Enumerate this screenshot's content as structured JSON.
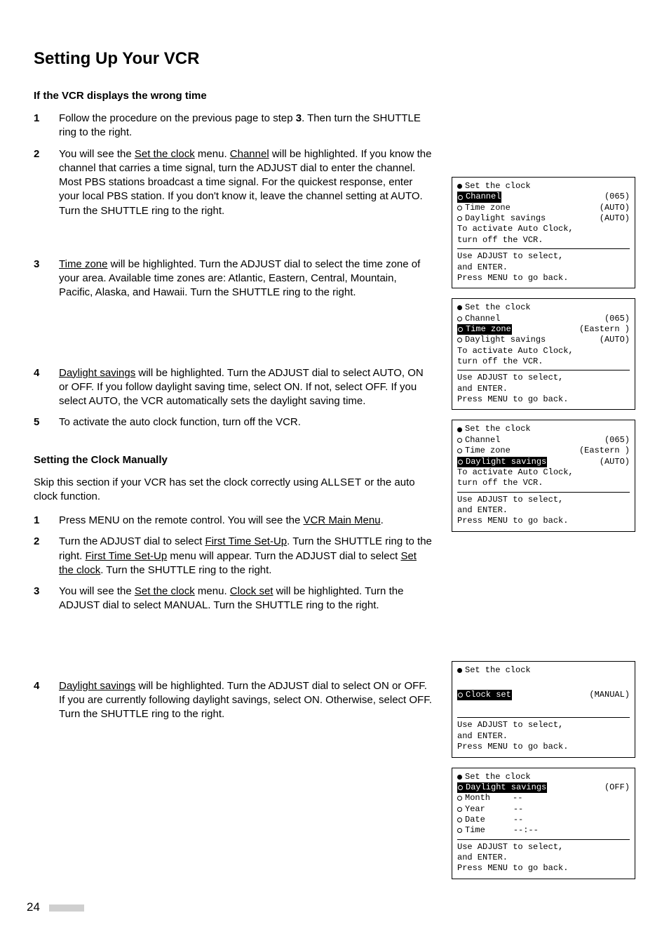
{
  "title": "Setting Up Your VCR",
  "section1": {
    "heading": "If the VCR displays the wrong time",
    "steps": {
      "s1": {
        "n": "1",
        "a": "Follow the procedure on the previous page to step ",
        "b": "3",
        "c": ".  Then turn the SHUTTLE ring to the right."
      },
      "s2": {
        "n": "2",
        "a": "You will see the ",
        "u1": "Set the clock",
        "b": " menu.  ",
        "u2": "Channel",
        "c": " will be highlighted.  If you know the channel that carries a time signal, turn the ADJUST dial to enter the channel.  Most PBS stations broadcast a time signal.  For the quickest response, enter your local PBS station.  If you don't know it, leave the channel setting at AUTO.  Turn the SHUTTLE ring to the right."
      },
      "s3": {
        "n": "3",
        "u1": "Time zone",
        "a": " will be highlighted.  Turn the ADJUST dial to select the time zone of your area.  Available time zones are:  Atlantic, Eastern, Central, Mountain, Pacific, Alaska, and Hawaii.  Turn the SHUTTLE ring to the right."
      },
      "s4": {
        "n": "4",
        "u1": "Daylight savings",
        "a": " will be highlighted.  Turn the ADJUST dial to select AUTO, ON or OFF.  If you follow daylight saving time, select ON.  If not, select OFF.  If you select AUTO, the VCR automatically sets the daylight saving time."
      },
      "s5": {
        "n": "5",
        "a": "To activate the auto clock function, turn off the VCR."
      }
    }
  },
  "section2": {
    "heading": "Setting the Clock Manually",
    "intro_a": "Skip this section if your VCR has set the clock correctly using A",
    "intro_sc": "LLSET",
    "intro_b": " or the auto clock function.",
    "steps": {
      "s1": {
        "n": "1",
        "a": "Press MENU on the remote control.  You will see the ",
        "u1": "VCR Main Menu",
        "b": "."
      },
      "s2": {
        "n": "2",
        "a": "Turn the ADJUST dial to select ",
        "u1": "First Time Set-Up",
        "b": ".  Turn the SHUTTLE ring to the right.  ",
        "u2": "First Time Set-Up",
        "c": " menu will appear.  Turn the ADJUST dial to select ",
        "u3": "Set the clock",
        "d": ".  Turn the SHUTTLE ring to the right."
      },
      "s3": {
        "n": "3",
        "a": "You will see the ",
        "u1": "Set the clock",
        "b": " menu.  ",
        "u2": "Clock set",
        "c": " will be highlighted.  Turn the ADJUST dial to select MANUAL.  Turn the SHUTTLE ring to the right."
      },
      "s4": {
        "n": "4",
        "u1": "Daylight savings",
        "a": " will be highlighted.  Turn the ADJUST dial to select ON or OFF.  If you are currently following daylight savings, select ON.  Otherwise, select OFF.  Turn the SHUTTLE ring to the right."
      }
    }
  },
  "screens": {
    "s1": {
      "title": "Set the clock",
      "channel_lbl": "Channel",
      "channel_val": "(065)",
      "tz_lbl": "Time zone",
      "tz_val": "(AUTO)",
      "dst_lbl": "Daylight savings",
      "dst_val": "(AUTO)",
      "line1": "To activate Auto Clock,",
      "line2": "turn off the VCR.",
      "help1": "Use ADJUST to select,",
      "help2": "and ENTER.",
      "help3": "Press MENU to go back."
    },
    "s2": {
      "title": "Set the clock",
      "channel_lbl": "Channel",
      "channel_val": "(065)",
      "tz_lbl": "Time zone",
      "tz_val": "(Eastern )",
      "dst_lbl": "Daylight savings",
      "dst_val": "(AUTO)",
      "line1": "To activate Auto Clock,",
      "line2": "turn off the VCR.",
      "help1": "Use ADJUST to select,",
      "help2": "and ENTER.",
      "help3": "Press MENU to go back."
    },
    "s3": {
      "title": "Set the clock",
      "channel_lbl": "Channel",
      "channel_val": "(065)",
      "tz_lbl": "Time zone",
      "tz_val": "(Eastern )",
      "dst_lbl": "Daylight savings",
      "dst_val": "(AUTO)",
      "line1": "To activate Auto Clock,",
      "line2": "turn off the VCR.",
      "help1": "Use ADJUST to select,",
      "help2": "and ENTER.",
      "help3": "Press MENU to go back."
    },
    "s4": {
      "title": "Set the clock",
      "clock_lbl": "Clock set",
      "clock_val": "(MANUAL)",
      "help1": "Use ADJUST to select,",
      "help2": "and ENTER.",
      "help3": "Press MENU to go back."
    },
    "s5": {
      "title": "Set the clock",
      "dst_lbl": "Daylight savings",
      "dst_val": "(OFF)",
      "month_lbl": "Month",
      "month_val": "--",
      "year_lbl": "Year",
      "year_val": "--",
      "date_lbl": "Date",
      "date_val": "--",
      "time_lbl": "Time",
      "time_val": "--:--",
      "help1": "Use ADJUST to select,",
      "help2": "and ENTER.",
      "help3": "Press MENU to go back."
    }
  },
  "page_number": "24"
}
